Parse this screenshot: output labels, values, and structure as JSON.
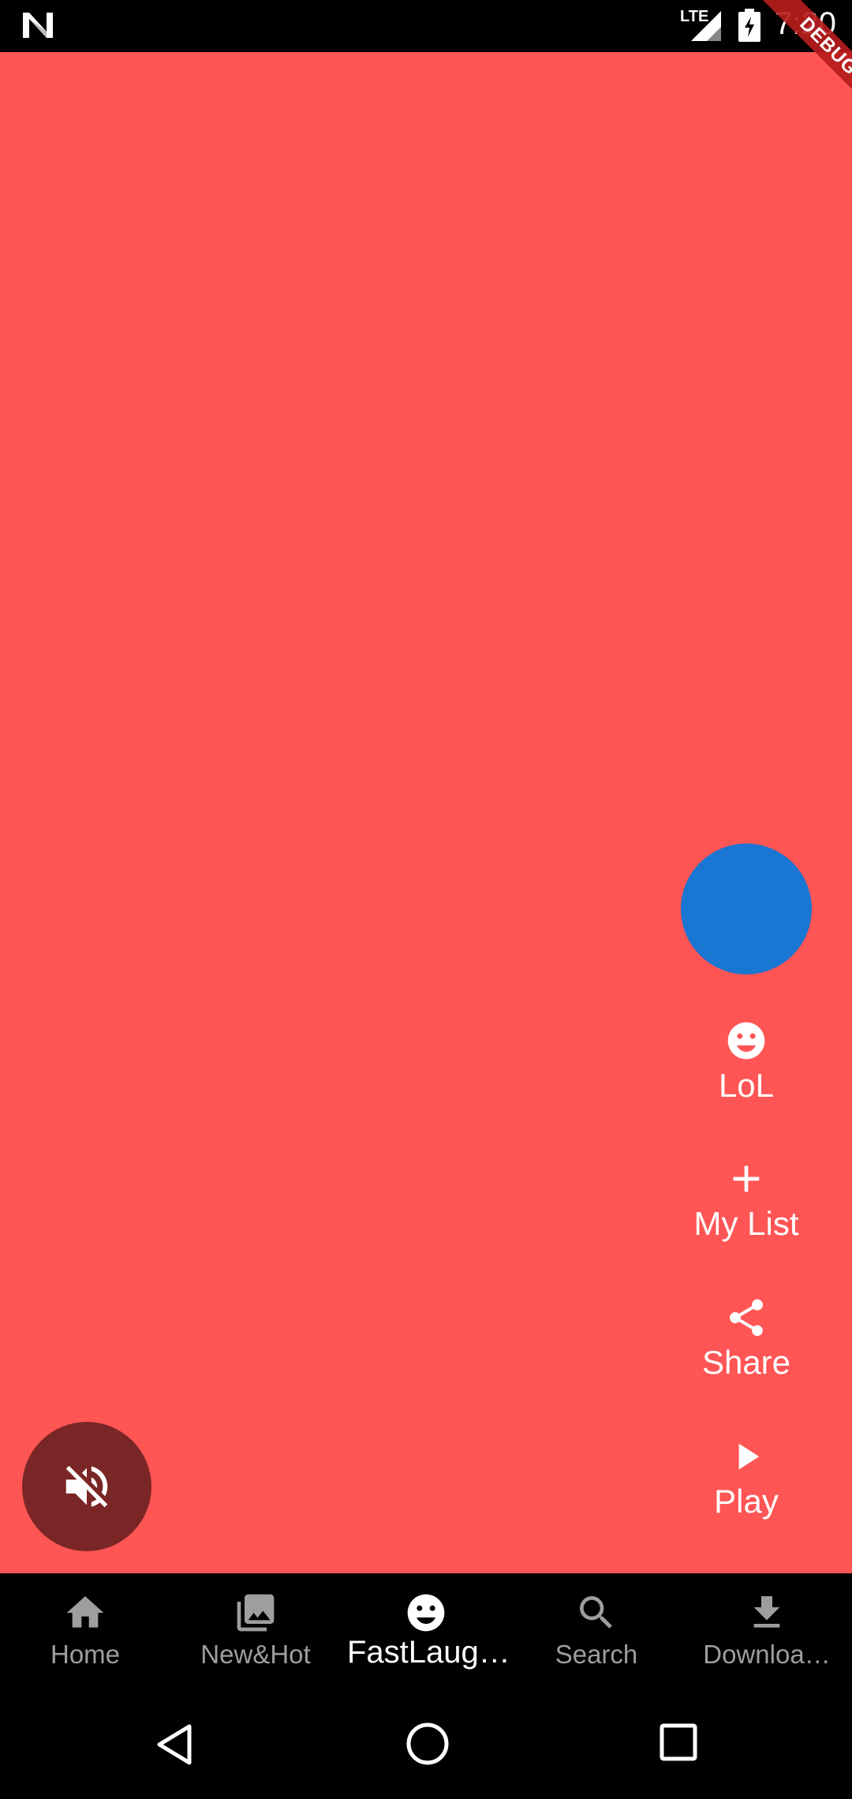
{
  "status_bar": {
    "network": "LTE",
    "time": "7:20",
    "debug_label": "DEBUG"
  },
  "actions": {
    "lol_label": "LoL",
    "my_list_label": "My List",
    "share_label": "Share",
    "play_label": "Play"
  },
  "bottom_nav": {
    "items": [
      {
        "label": "Home",
        "icon": "home-icon",
        "active": false
      },
      {
        "label": "New&Hot",
        "icon": "photo-library-icon",
        "active": false
      },
      {
        "label": "FastLaug…",
        "icon": "emoji-smile-icon",
        "active": true
      },
      {
        "label": "Search",
        "icon": "search-icon",
        "active": false
      },
      {
        "label": "Downloa…",
        "icon": "download-icon",
        "active": false
      }
    ]
  },
  "colors": {
    "background": "#FF5555",
    "avatar": "#1976D2",
    "mute_button": "#7B2626",
    "nav_background": "#000000",
    "nav_inactive": "#9E9E9E",
    "nav_active": "#FFFFFF"
  }
}
